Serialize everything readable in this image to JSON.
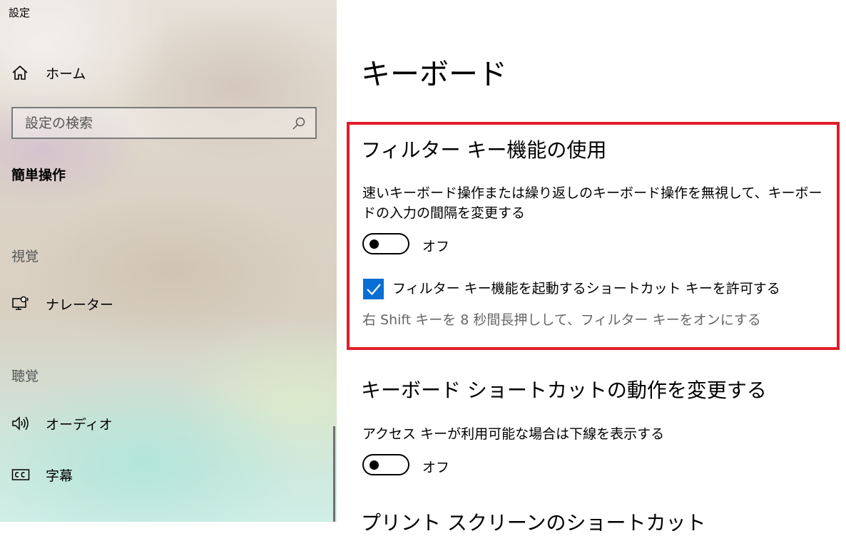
{
  "window": {
    "title": "設定"
  },
  "sidebar": {
    "home_label": "ホーム",
    "search_placeholder": "設定の検索",
    "section_title": "簡単操作",
    "group_vision": "視覚",
    "narrator_label": "ナレーター",
    "group_hearing": "聴覚",
    "audio_label": "オーディオ",
    "captions_label": "字幕"
  },
  "main": {
    "page_title": "キーボード",
    "filter_keys": {
      "heading": "フィルター キー機能の使用",
      "description": "速いキーボード操作または繰り返しのキーボード操作を無視して、キーボードの入力の間隔を変更する",
      "toggle_state": "オフ",
      "shortcut_checkbox_label": "フィルター キー機能を起動するショートカット キーを許可する",
      "shortcut_checked": true,
      "shortcut_hint": "右 Shift キーを 8 秒間長押しして、フィルター キーをオンにする"
    },
    "shortcuts": {
      "heading": "キーボード ショートカットの動作を変更する",
      "underline_label": "アクセス キーが利用可能な場合は下線を表示する",
      "toggle_state": "オフ"
    },
    "next_heading_partial": "プリント スクリーンのショートカット"
  },
  "colors": {
    "highlight_border": "#e11d2a",
    "checkbox_accent": "#0a6fd4"
  }
}
